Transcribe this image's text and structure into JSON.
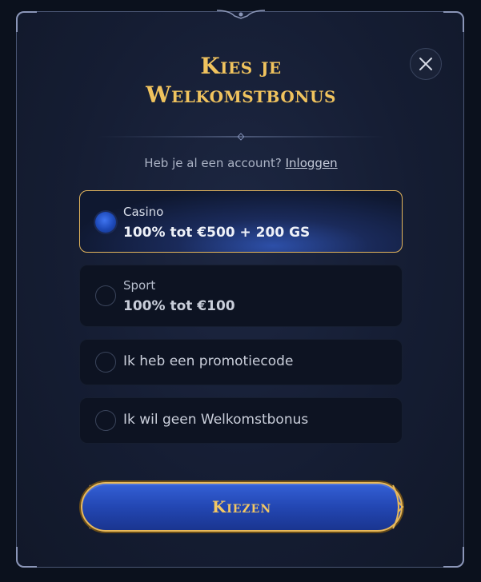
{
  "modal": {
    "title_line1": "Kies je",
    "title_line2": "Welkomstbonus",
    "close_icon": "close-icon",
    "login_prompt": "Heb je al een account?",
    "login_link": "Inloggen"
  },
  "options": [
    {
      "label": "Casino",
      "value": "100% tot €500 + 200 GS",
      "selected": true
    },
    {
      "label": "Sport",
      "value": "100% tot €100",
      "selected": false
    },
    {
      "label": "Ik heb een promotiecode",
      "selected": false
    },
    {
      "label": "Ik wil geen Welkomstbonus",
      "selected": false
    }
  ],
  "actions": {
    "choose_label": "Kiezen"
  },
  "colors": {
    "accent_gold": "#f0c35e",
    "button_blue": "#2347b3",
    "panel": "#151d33"
  }
}
